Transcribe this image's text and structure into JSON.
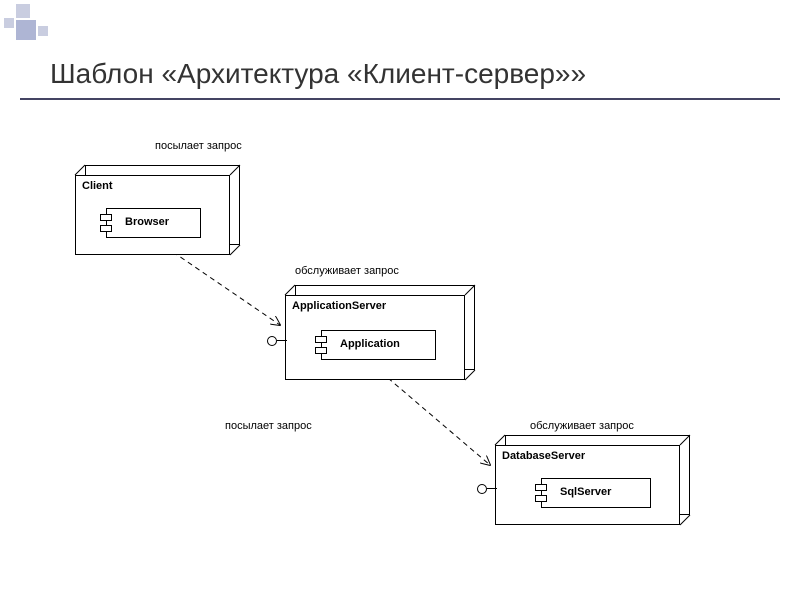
{
  "title": "Шаблон «Архитектура «Клиент-сервер»»",
  "labels": {
    "send1": "посылает запрос",
    "serve1": "обслуживает запрос",
    "send2": "посылает запрос",
    "serve2": "обслуживает запрос"
  },
  "nodes": {
    "client": {
      "name": "Client",
      "component": "Browser"
    },
    "appserver": {
      "name": "ApplicationServer",
      "component": "Application"
    },
    "dbserver": {
      "name": "DatabaseServer",
      "component": "SqlServer"
    }
  }
}
